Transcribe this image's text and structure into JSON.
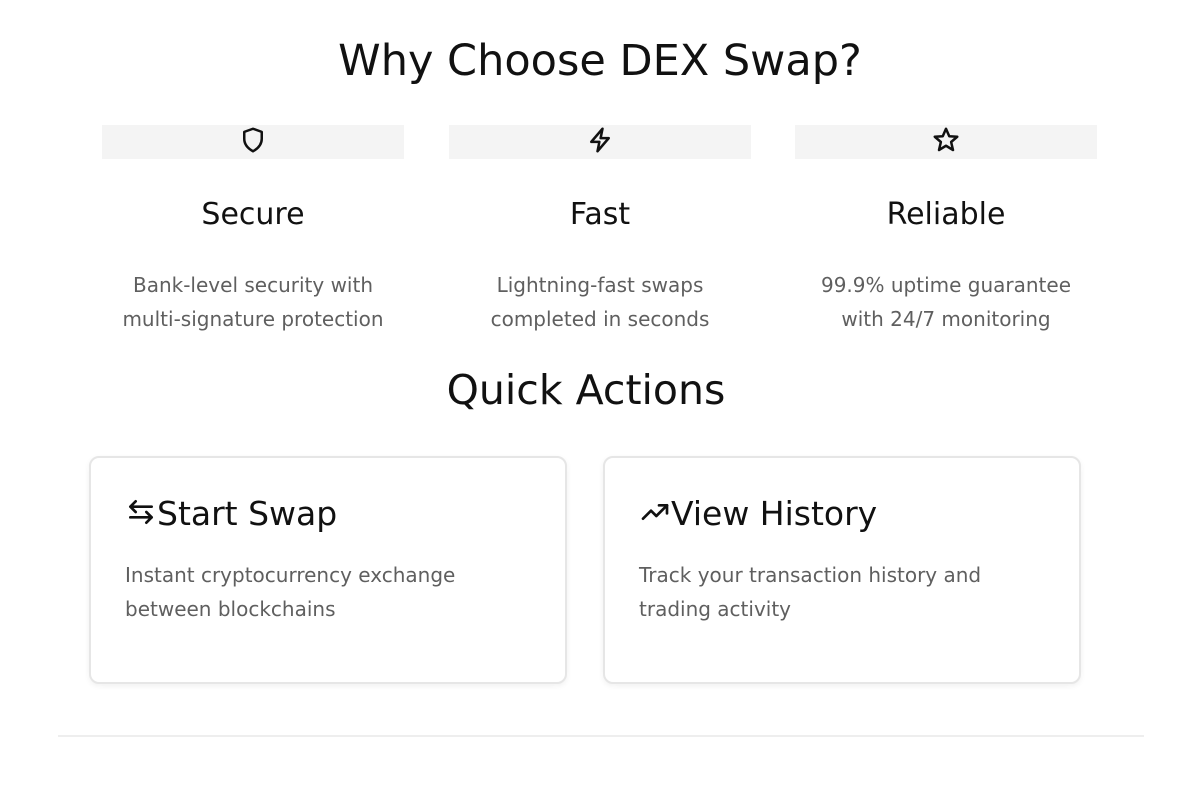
{
  "why_section": {
    "title": "Why Choose DEX Swap?",
    "features": [
      {
        "icon": "shield-icon",
        "title": "Secure",
        "description": "Bank-level security with multi-signature protection"
      },
      {
        "icon": "lightning-icon",
        "title": "Fast",
        "description": "Lightning-fast swaps completed in seconds"
      },
      {
        "icon": "star-icon",
        "title": "Reliable",
        "description": "99.9% uptime guarantee with 24/7 monitoring"
      }
    ]
  },
  "quick_actions": {
    "title": "Quick Actions",
    "cards": [
      {
        "icon": "swap-arrows-icon",
        "title": "Start Swap",
        "description": "Instant cryptocurrency exchange between blockchains"
      },
      {
        "icon": "trending-up-icon",
        "title": "View History",
        "description": "Track your transaction history and trading activity"
      }
    ]
  },
  "colors": {
    "text_primary": "#111111",
    "text_secondary": "#5f5f5f",
    "icon_bar": "#f4f4f4",
    "card_border": "#e6e6e6"
  }
}
